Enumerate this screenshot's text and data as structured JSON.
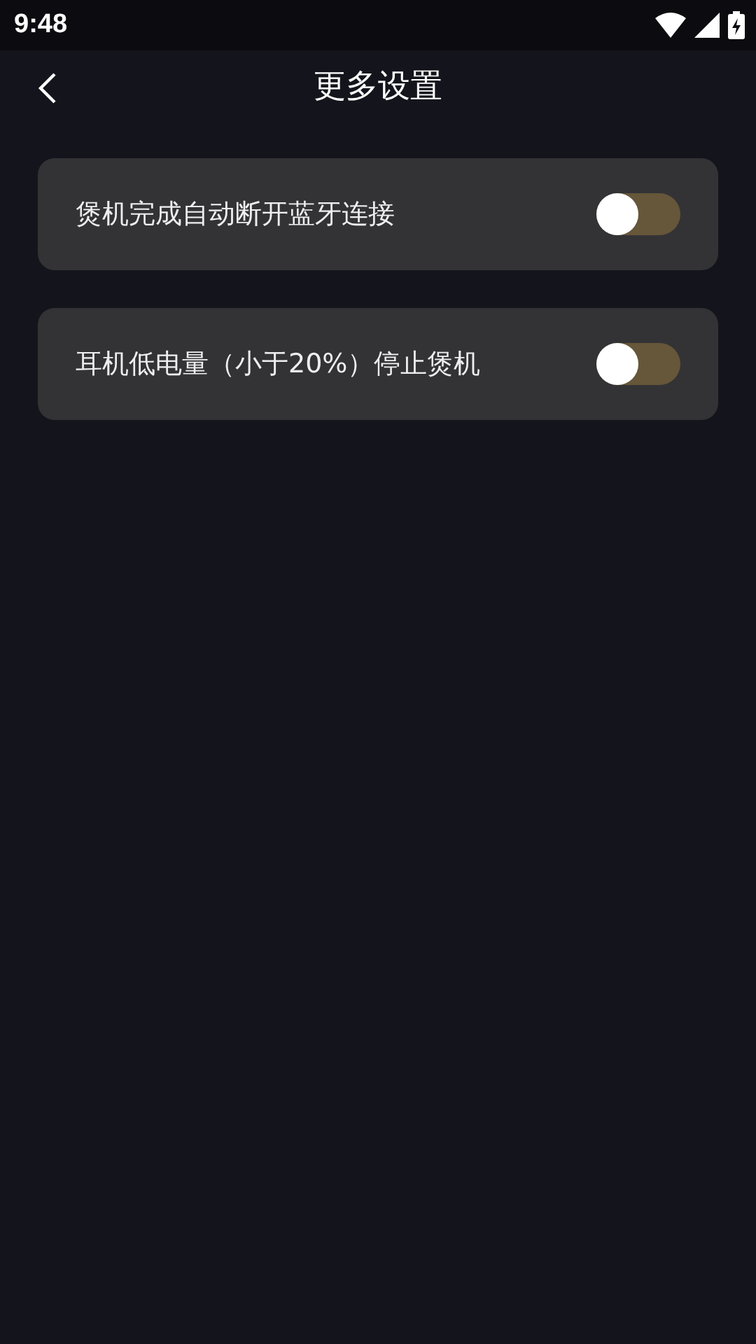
{
  "status_bar": {
    "time": "9:48"
  },
  "header": {
    "title": "更多设置"
  },
  "settings": [
    {
      "label": "煲机完成自动断开蓝牙连接",
      "on": false
    },
    {
      "label": "耳机低电量（小于20%）停止煲机",
      "on": false
    }
  ]
}
